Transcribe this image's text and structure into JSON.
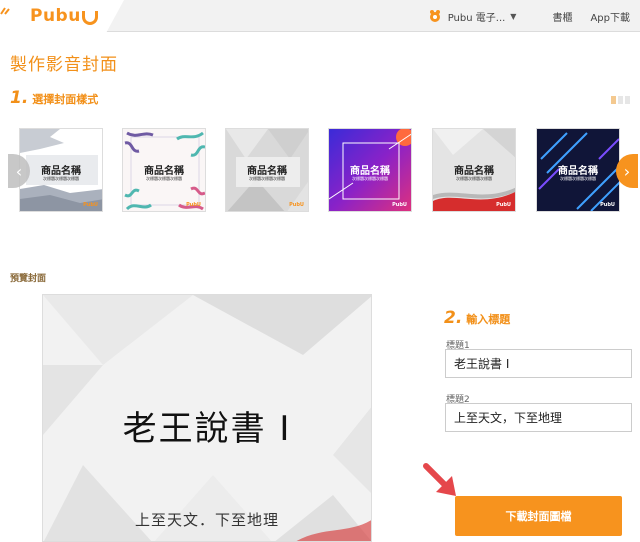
{
  "header": {
    "logo_text": "Pubu",
    "user_label": "Pubu 電子...",
    "nav_links": [
      "書櫃",
      "App下載"
    ]
  },
  "page": {
    "title": "製作影音封面",
    "step1": {
      "number": "1.",
      "label": "選擇封面樣式"
    },
    "step2": {
      "number": "2.",
      "label": "輸入標題"
    },
    "preview_label": "預覽封面"
  },
  "templates": [
    {
      "title": "商品名稱",
      "subtitle": "次標題次標題次標題",
      "logo": "PubU",
      "style": "grunge"
    },
    {
      "title": "商品名稱",
      "subtitle": "次標題次標題次標題",
      "logo": "PubU",
      "style": "floral"
    },
    {
      "title": "商品名稱",
      "subtitle": "次標題次標題次標題",
      "logo": "PubU",
      "style": "gray-geometric"
    },
    {
      "title": "商品名稱",
      "subtitle": "次標題次標題次標題",
      "logo": "PubU",
      "style": "purple-neon"
    },
    {
      "title": "商品名稱",
      "subtitle": "次標題次標題次標題",
      "logo": "PubU",
      "style": "red-wave"
    },
    {
      "title": "商品名稱",
      "subtitle": "次標題次標題次標題",
      "logo": "PubU",
      "style": "dark-streaks"
    }
  ],
  "preview": {
    "title": "老王說書 I",
    "subtitle": "上至天文．下至地理"
  },
  "form": {
    "field1_label": "標題1",
    "field1_value": "老王說書 I",
    "field2_label": "標題2",
    "field2_value": "上至天文，下至地理",
    "download_label": "下載封面圖檔"
  },
  "colors": {
    "accent": "#f7931e",
    "pointer": "#e5474b"
  }
}
